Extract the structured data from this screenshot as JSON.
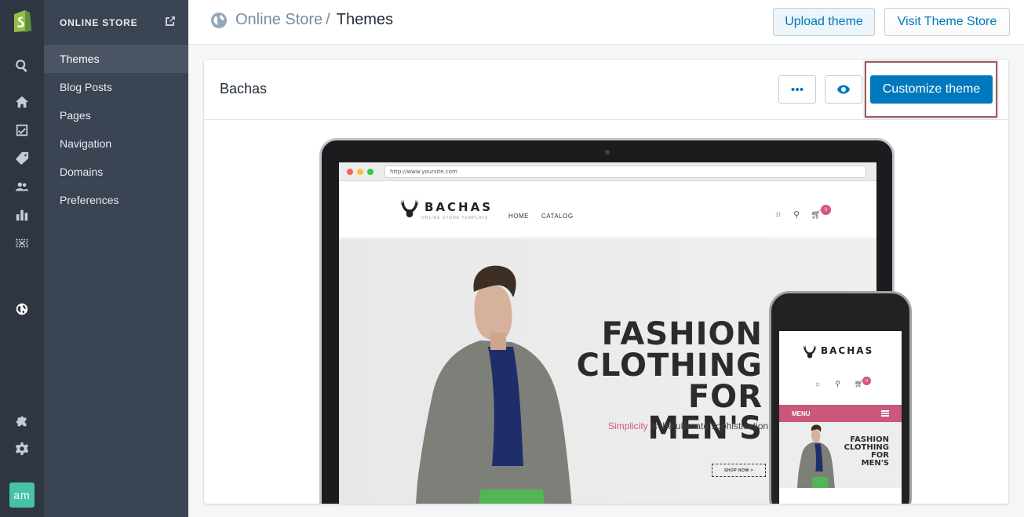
{
  "rail": {
    "avatar_initials": "am",
    "icons": [
      "search-icon",
      "home-icon",
      "orders-icon",
      "products-icon",
      "customers-icon",
      "reports-icon",
      "discounts-icon",
      "online-store-icon",
      "apps-icon",
      "settings-icon"
    ]
  },
  "subnav": {
    "title": "ONLINE STORE",
    "items": [
      {
        "label": "Themes"
      },
      {
        "label": "Blog Posts"
      },
      {
        "label": "Pages"
      },
      {
        "label": "Navigation"
      },
      {
        "label": "Domains"
      },
      {
        "label": "Preferences"
      }
    ]
  },
  "header": {
    "breadcrumb_parent": "Online Store",
    "breadcrumb_sep": "/",
    "title": "Themes",
    "upload_label": "Upload theme",
    "visit_label": "Visit Theme Store"
  },
  "theme": {
    "name": "Bachas",
    "customize_label": "Customize theme"
  },
  "preview": {
    "url": "http://www.yoursite.com",
    "brand": "BACHAS",
    "brand_tagline": "ONLINE STORE TEMPLATE",
    "nav": [
      "HOME",
      "CATALOG"
    ],
    "cart_count": "0",
    "hero_lines": [
      "FASHION",
      "CLOTHING",
      "FOR MEN'S"
    ],
    "hero_sub_accent": "Simplicity",
    "hero_sub_rest": " is the ultimate sophistication",
    "shop_now": "SHOP NOW  >",
    "mobile_menu": "MENU"
  },
  "colors": {
    "rail_bg": "#2e3643",
    "subnav_bg": "#3a4452",
    "primary": "#0078bd",
    "accent_pink": "#d6577a"
  }
}
